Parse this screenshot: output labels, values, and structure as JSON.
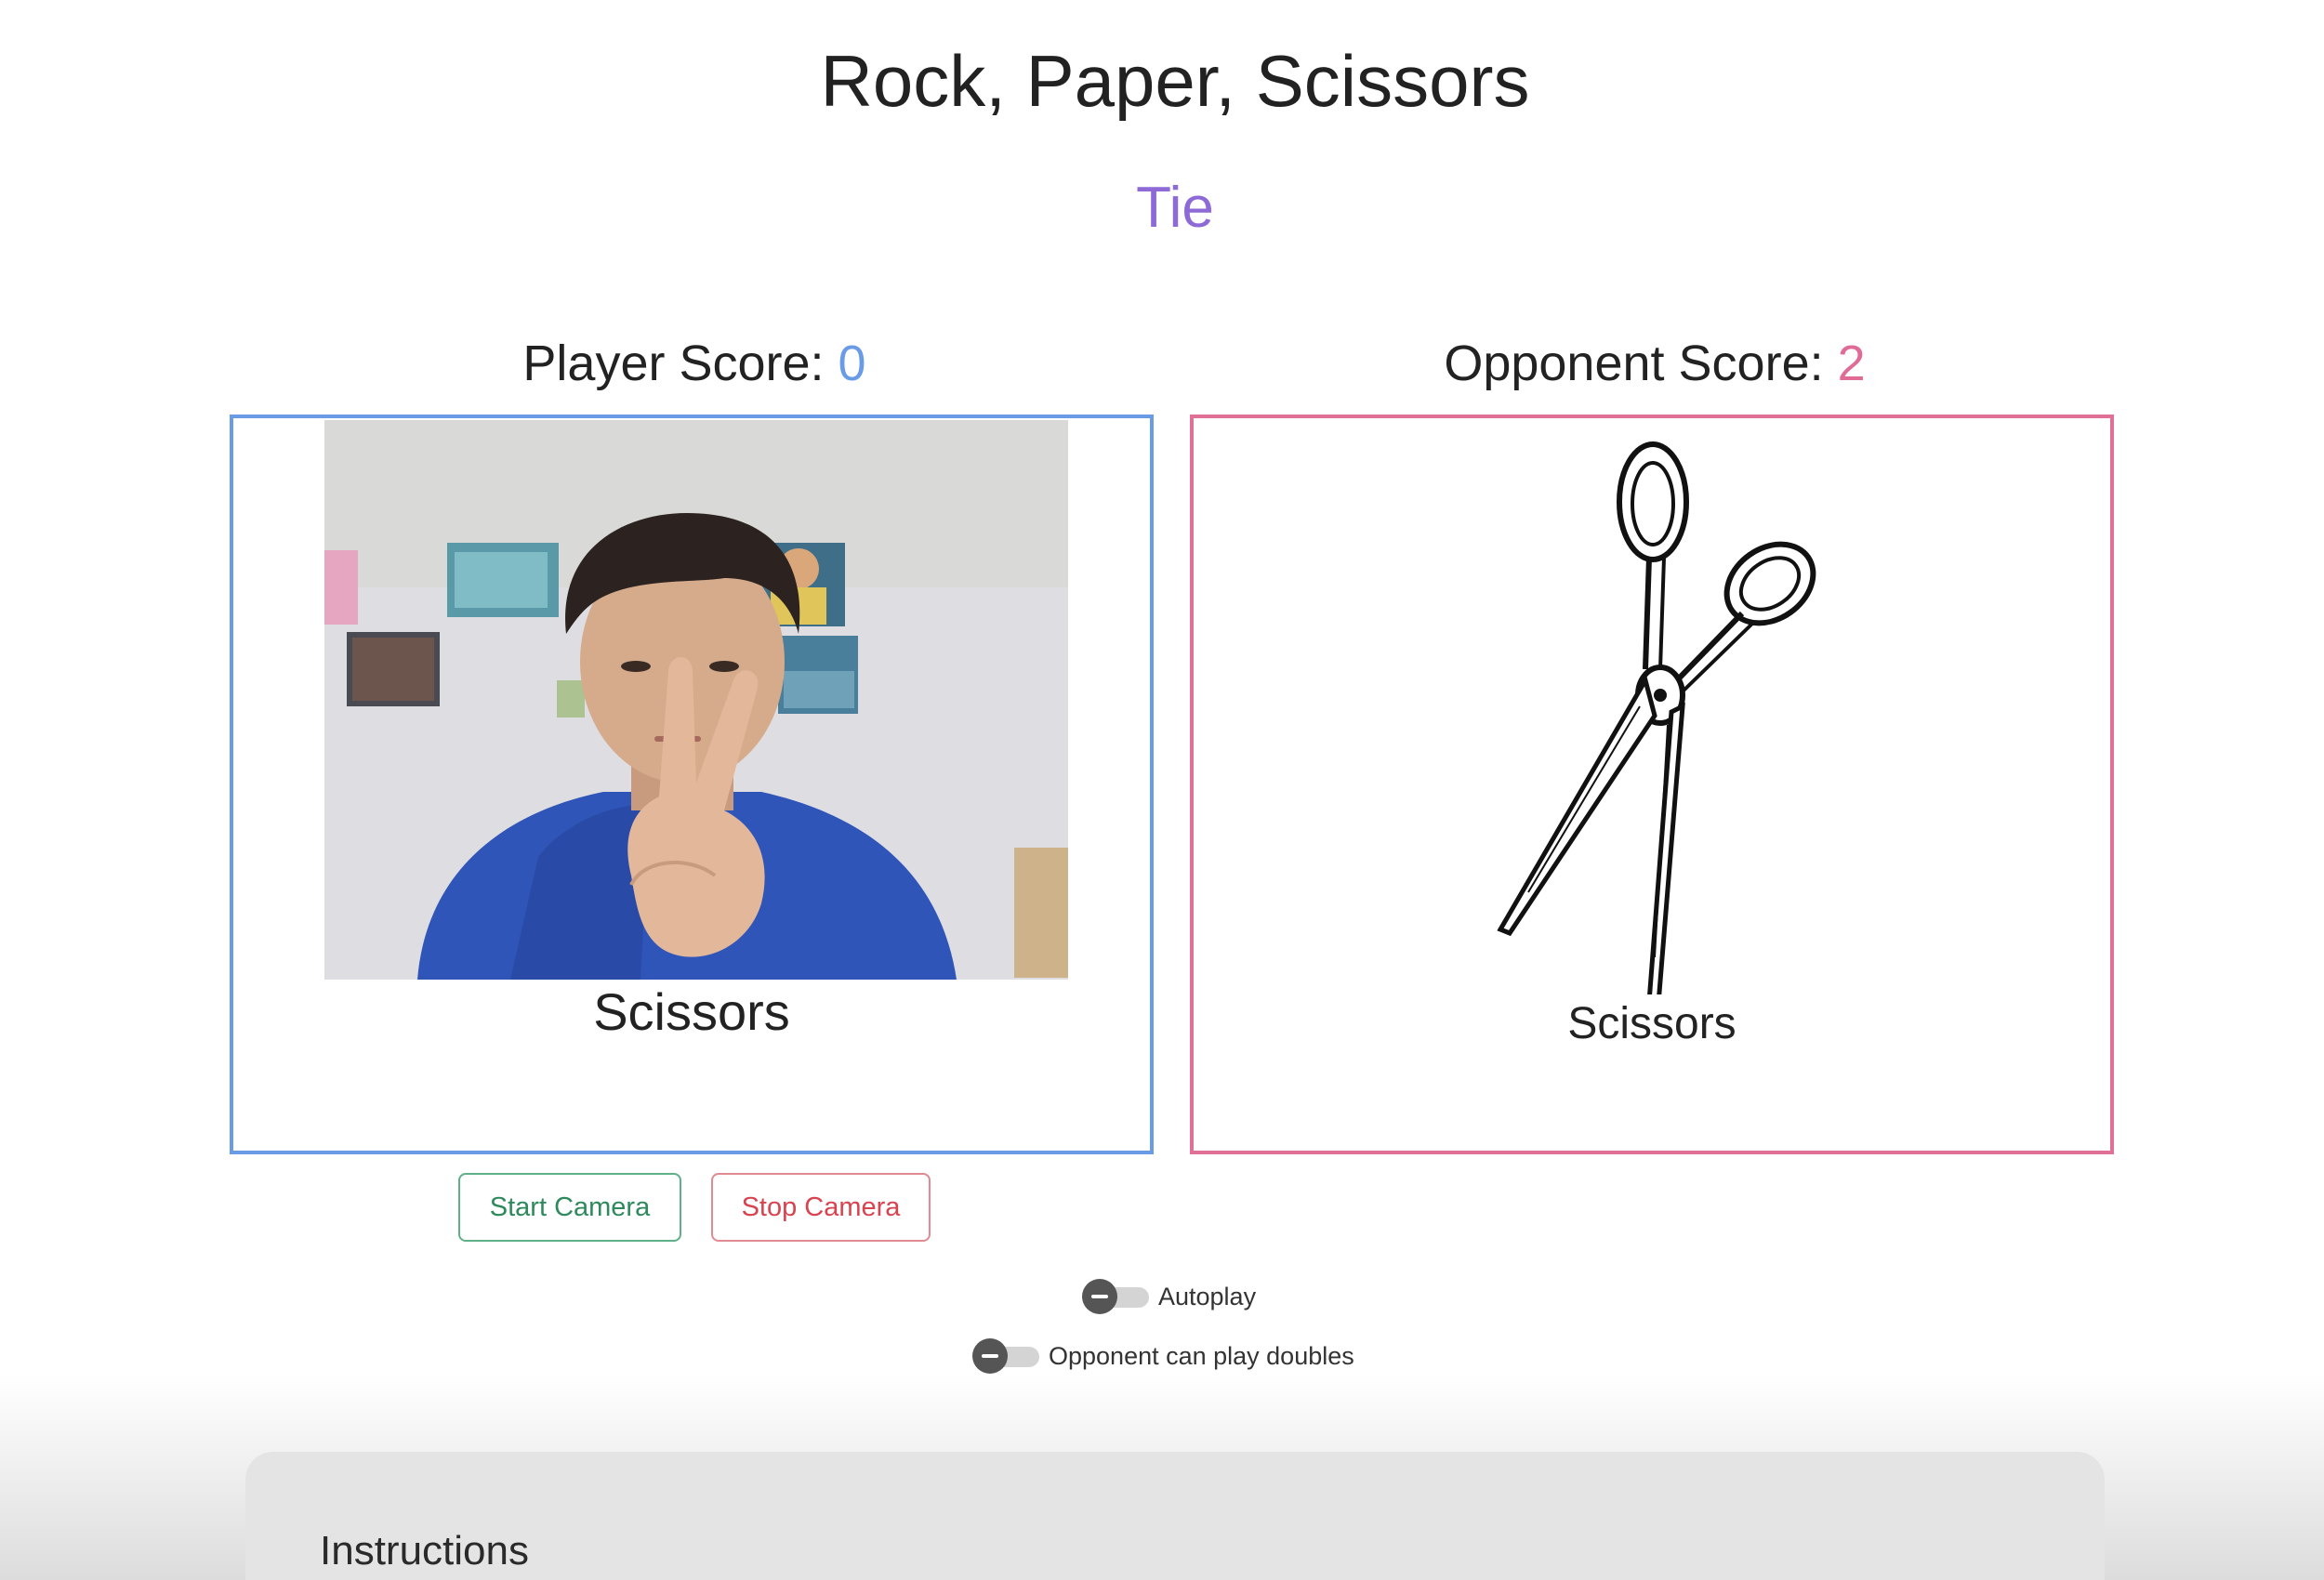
{
  "title": "Rock, Paper, Scissors",
  "result": "Tie",
  "player": {
    "score_label": "Player Score:",
    "score": "0",
    "choice": "Scissors"
  },
  "opponent": {
    "score_label": "Opponent Score:",
    "score": "2",
    "choice": "Scissors"
  },
  "camera": {
    "start_label": "Start Camera",
    "stop_label": "Stop Camera"
  },
  "toggles": {
    "autoplay_label": "Autoplay",
    "autoplay_on": false,
    "doubles_label": "Opponent can play doubles",
    "doubles_on": false
  },
  "instructions": {
    "title": "Instructions"
  },
  "colors": {
    "player_accent": "#6a9be6",
    "opponent_accent": "#e07095",
    "result": "#8e6ad6",
    "start_button": "#2e8a5c",
    "stop_button": "#d9434f"
  }
}
